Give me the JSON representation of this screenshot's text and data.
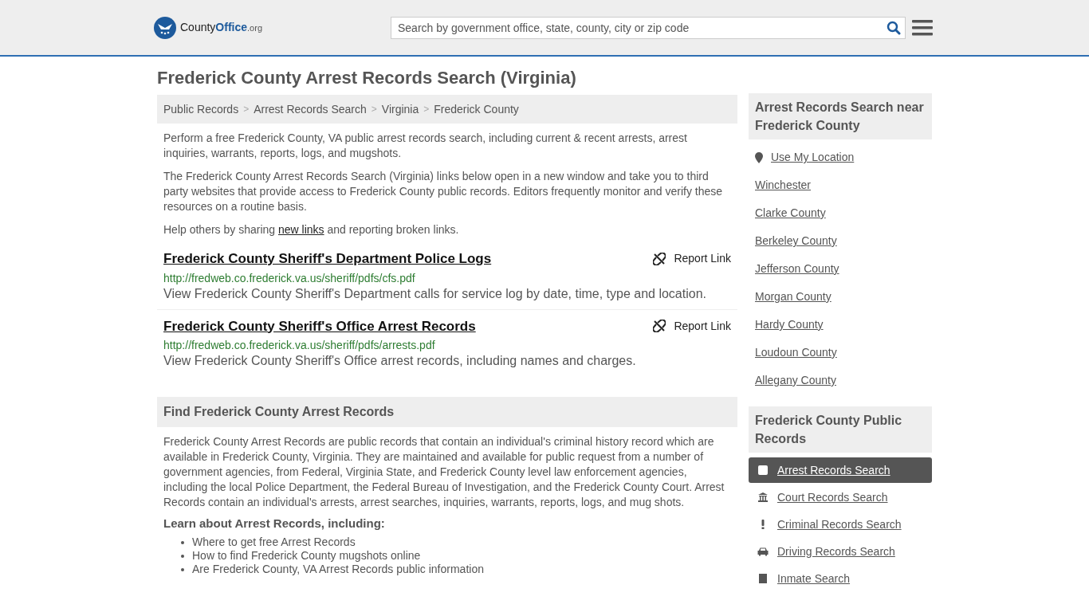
{
  "header": {
    "logo": {
      "name": "County",
      "highlight": "Office",
      "suffix": ".org"
    },
    "search": {
      "placeholder": "Search by government office, state, county, city or zip code"
    }
  },
  "title": "Frederick County Arrest Records Search (Virginia)",
  "breadcrumbs": [
    "Public Records",
    "Arrest Records Search",
    "Virginia",
    "Frederick County"
  ],
  "breadcrumb_separator": ">",
  "intro": [
    "Perform a free Frederick County, VA public arrest records search, including current & recent arrests, arrest inquiries, warrants, reports, logs, and mugshots.",
    "The Frederick County Arrest Records Search (Virginia) links below open in a new window and take you to third party websites that provide access to Frederick County public records. Editors frequently monitor and verify these resources on a routine basis."
  ],
  "share": {
    "before": "Help others by sharing ",
    "link": "new links",
    "after": " and reporting broken links."
  },
  "links": [
    {
      "title": "Frederick County Sheriff's Department Police Logs",
      "url": "http://fredweb.co.frederick.va.us/sheriff/pdfs/cfs.pdf",
      "description": "View Frederick County Sheriff's Department calls for service log by date, time, type and location.",
      "report": "Report Link"
    },
    {
      "title": "Frederick County Sheriff's Office Arrest Records",
      "url": "http://fredweb.co.frederick.va.us/sheriff/pdfs/arrests.pdf",
      "description": "View Frederick County Sheriff's Office arrest records, including names and charges.",
      "report": "Report Link"
    }
  ],
  "find": {
    "heading": "Find Frederick County Arrest Records",
    "body": "Frederick County Arrest Records are public records that contain an individual's criminal history record which are available in Frederick County, Virginia. They are maintained and available for public request from a number of government agencies, from Federal, Virginia State, and Frederick County level law enforcement agencies, including the local Police Department, the Federal Bureau of Investigation, and the Frederick County Court. Arrest Records contain an individual's arrests, arrest searches, inquiries, warrants, reports, logs, and mug shots.",
    "subheading": "Learn about Arrest Records, including:",
    "bullets": [
      "Where to get free Arrest Records",
      "How to find Frederick County mugshots online",
      "Are Frederick County, VA Arrest Records public information"
    ]
  },
  "nearby": {
    "heading": "Arrest Records Search near Frederick County",
    "location": "Use My Location",
    "items": [
      "Winchester",
      "Clarke County",
      "Berkeley County",
      "Jefferson County",
      "Morgan County",
      "Hardy County",
      "Loudoun County",
      "Allegany County"
    ]
  },
  "public_records": {
    "heading": "Frederick County Public Records",
    "items": [
      {
        "label": "Arrest Records Search",
        "kind": "square",
        "selected": true
      },
      {
        "label": "Court Records Search",
        "kind": "court",
        "selected": false
      },
      {
        "label": "Criminal Records Search",
        "kind": "alert",
        "selected": false
      },
      {
        "label": "Driving Records Search",
        "kind": "car",
        "selected": false
      },
      {
        "label": "Inmate Search",
        "kind": "inmate",
        "selected": false
      }
    ]
  }
}
